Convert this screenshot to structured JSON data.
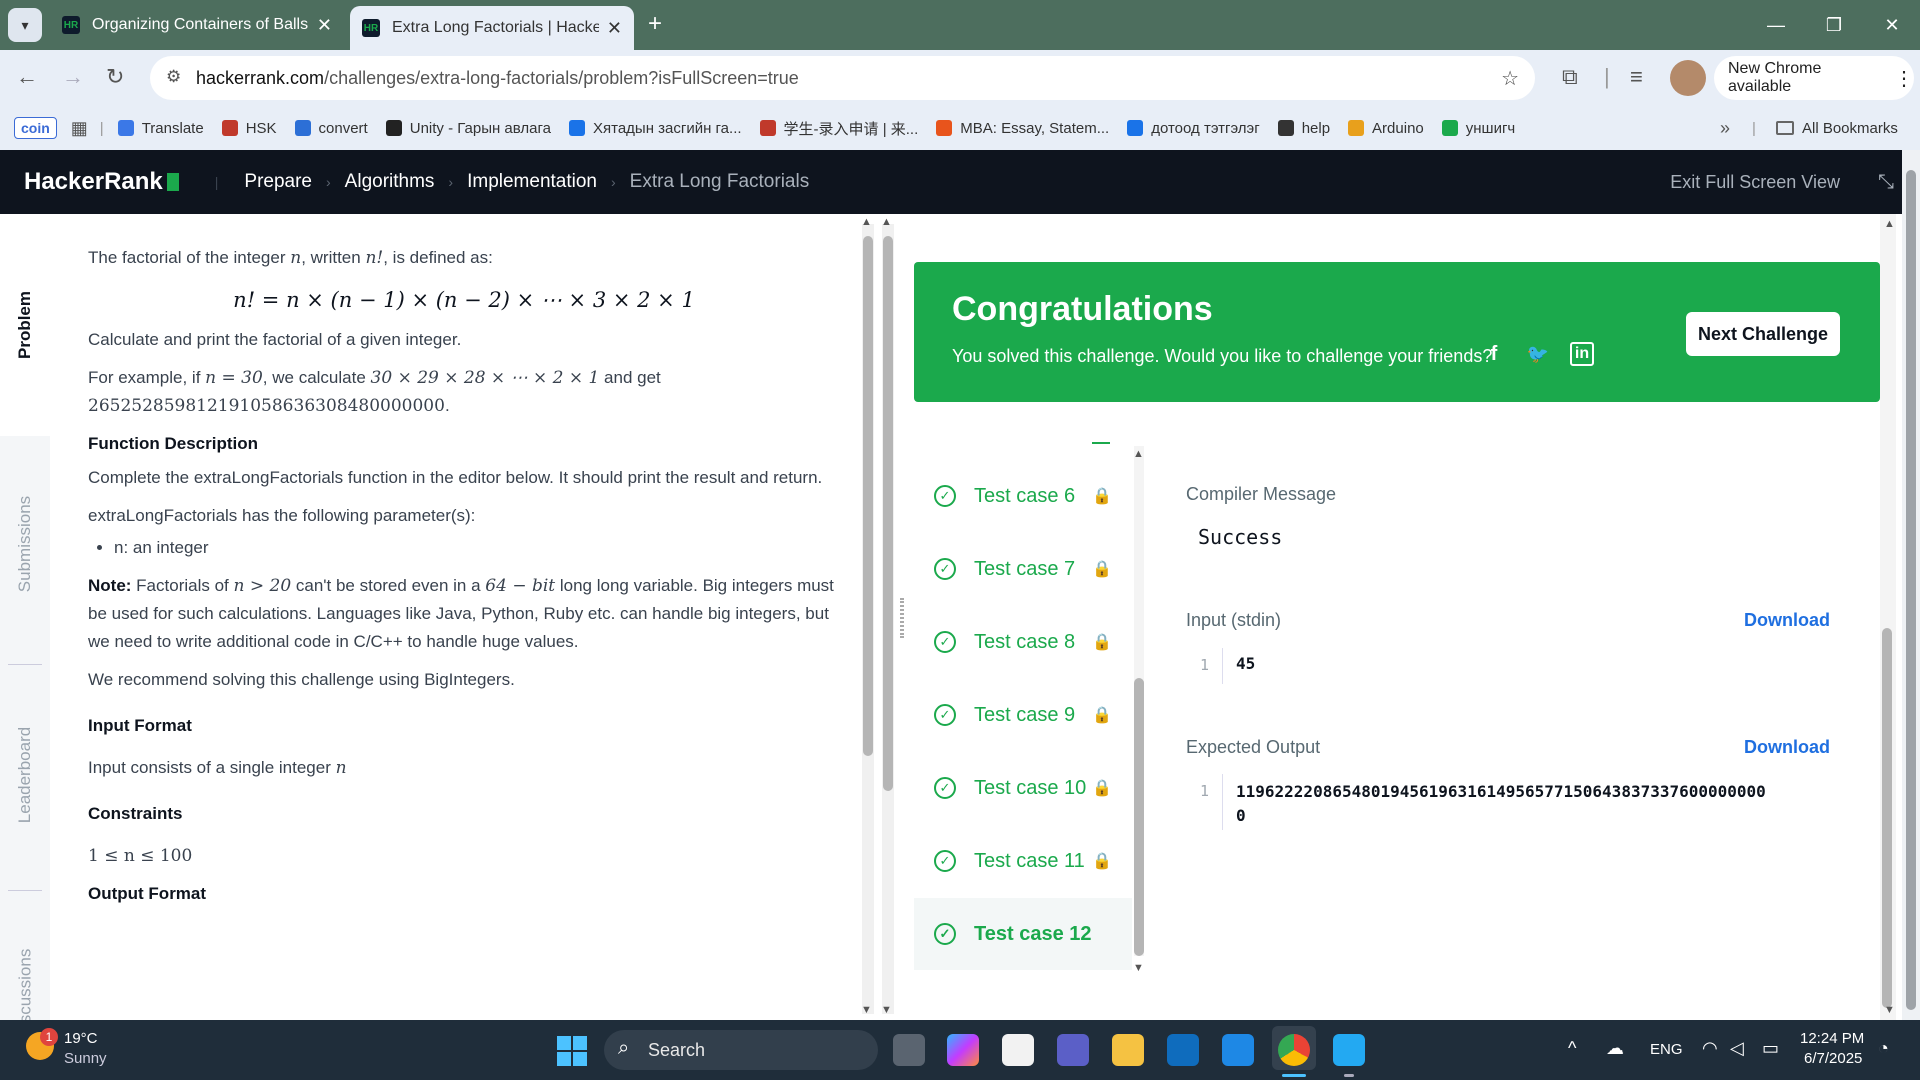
{
  "browser": {
    "tabs": [
      {
        "title": "Organizing Containers of Balls |",
        "active": false
      },
      {
        "title": "Extra Long Factorials | HackerRa",
        "active": true
      }
    ],
    "url_host": "hackerrank.com",
    "url_path": "/challenges/extra-long-factorials/problem?isFullScreen=true",
    "new_chrome": "New Chrome available",
    "bookmarks": [
      {
        "label": "coin"
      },
      {
        "label": "Translate",
        "color": "#3b78e7"
      },
      {
        "label": "HSK",
        "color": "#c0392b"
      },
      {
        "label": "convert",
        "color": "#2c6fd6"
      },
      {
        "label": "Unity - Гарын авлага",
        "color": "#222222"
      },
      {
        "label": "Хятадын засгийн га...",
        "color": "#1a73e8"
      },
      {
        "label": "学生-录入申请 | 来...",
        "color": "#c0392b"
      },
      {
        "label": "MBA: Essay, Statem...",
        "color": "#e8541c"
      },
      {
        "label": "дотоод тэтгэлэг",
        "color": "#1a73e8"
      },
      {
        "label": "help",
        "color": "#333333"
      },
      {
        "label": "Arduino",
        "color": "#e8a01c"
      },
      {
        "label": "уншигч",
        "color": "#1ba94c"
      }
    ],
    "all_bookmarks": "All Bookmarks"
  },
  "header": {
    "logo": "HackerRank",
    "breadcrumbs": [
      "Prepare",
      "Algorithms",
      "Implementation",
      "Extra Long Factorials"
    ],
    "exit_full_screen": "Exit Full Screen View"
  },
  "side_tabs": [
    "Problem",
    "Submissions",
    "Leaderboard",
    "Discussions"
  ],
  "problem": {
    "intro_a": "The factorial of the integer ",
    "intro_n": "n",
    "intro_b": ", written ",
    "intro_nf": "n!",
    "intro_c": ", is defined as:",
    "formula": "n! = n × (n − 1) × (n − 2) × ⋯ × 3 × 2 × 1",
    "task": "Calculate and print the factorial of a given integer.",
    "example_a": "For example, if ",
    "example_n": "n = 30",
    "example_b": ", we calculate ",
    "example_calc": "30 × 29 × 28 × ⋯ × 2 × 1",
    "example_c": " and get",
    "example_result": "265252859812191058636308480000000",
    "func_heading": "Function Description",
    "func_desc": "Complete the extraLongFactorials function in the editor below. It should print the result and return.",
    "params_intro": "extraLongFactorials has the following parameter(s):",
    "param_n": "n: an integer",
    "note_label": "Note:",
    "note_a": " Factorials of ",
    "note_cond": "n > 20",
    "note_b": " can't be stored even in a ",
    "note_bits": "64 − bit",
    "note_c": " long long variable. Big integers must be used for such calculations. Languages like Java, Python, Ruby etc. can handle big integers, but we need to write additional code in C/C++ to handle huge values.",
    "recommend": "We recommend solving this challenge using BigIntegers.",
    "input_heading": "Input Format",
    "input_desc": "Input consists of a single integer ",
    "input_n": "n",
    "constraints_heading": "Constraints",
    "constraint": "1 ≤ n ≤ 100",
    "output_heading": "Output Format"
  },
  "congrats": {
    "title": "Congratulations",
    "subtitle": "You solved this challenge. Would you like to challenge your friends?",
    "next_button": "Next Challenge",
    "social": [
      "facebook-icon",
      "twitter-icon",
      "linkedin-icon"
    ]
  },
  "test_cases": [
    {
      "label": "Test case 6"
    },
    {
      "label": "Test case 7"
    },
    {
      "label": "Test case 8"
    },
    {
      "label": "Test case 9"
    },
    {
      "label": "Test case 10"
    },
    {
      "label": "Test case 11"
    },
    {
      "label": "Test case 12",
      "selected": true
    }
  ],
  "detail": {
    "compiler_label": "Compiler Message",
    "compiler_value": "Success",
    "input_label": "Input (stdin)",
    "input_line_no": "1",
    "input_value": "45",
    "download": "Download",
    "expected_label": "Expected Output",
    "expected_line_no": "1",
    "expected_value_line1": "1196222208654801945619631614956577150643837337600000000",
    "expected_value_line2": "0"
  },
  "taskbar": {
    "weather_temp": "19°C",
    "weather_desc": "Sunny",
    "weather_badge": "1",
    "search": "Search",
    "lang": "ENG",
    "time": "12:24 PM",
    "date": "6/7/2025"
  },
  "colors": {
    "accent": "#1ba94c",
    "header_bg": "#0e141e",
    "link": "#1f6fe0"
  }
}
